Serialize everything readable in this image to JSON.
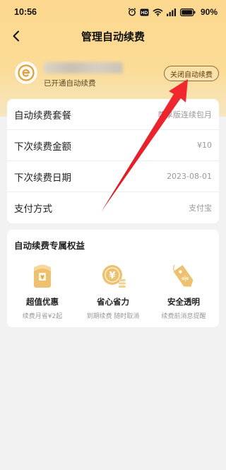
{
  "status_bar": {
    "time": "10:56",
    "battery": "90%"
  },
  "header": {
    "title": "管理自动续费",
    "back_icon": "chevron-left-icon"
  },
  "account": {
    "status": "已开通自动续费",
    "close_button": "关闭自动续费"
  },
  "details": [
    {
      "label": "自动续费套餐",
      "value": "尊享版连续包月"
    },
    {
      "label": "下次续费金额",
      "value": "¥10"
    },
    {
      "label": "下次续费日期",
      "value": "2023-08-01"
    },
    {
      "label": "支付方式",
      "value": "支付宝"
    }
  ],
  "benefits": {
    "title": "自动续费专属权益",
    "items": [
      {
        "name": "超值优惠",
        "desc": "续费月省¥2起",
        "icon": "gift-bag-icon"
      },
      {
        "name": "省心省力",
        "desc": "到期续费 随时取消",
        "icon": "coin-icon"
      },
      {
        "name": "安全透明",
        "desc": "续费前消息提醒",
        "icon": "discount-tag-icon"
      }
    ]
  },
  "colors": {
    "header_gradient_top": "#fdd88f",
    "accent_gold": "#e9b75e",
    "arrow_red": "#e3141b"
  }
}
